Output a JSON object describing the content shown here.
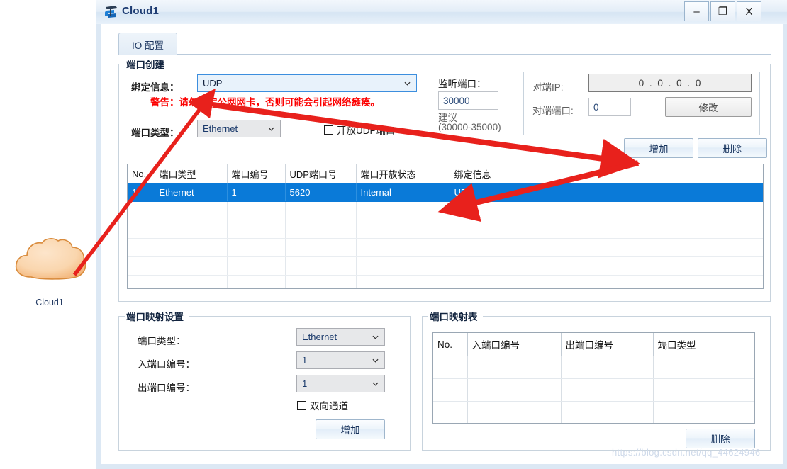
{
  "canvas": {
    "cloud_label": "Cloud1",
    "cloud_color": "#f8cfa4"
  },
  "window": {
    "title": "Cloud1",
    "icon": "cloud-device-icon",
    "controls": {
      "minimize": "–",
      "maximize": "❐",
      "close": "X"
    }
  },
  "tabs": [
    {
      "label": "IO 配置",
      "active": true
    }
  ],
  "port_create": {
    "group_title": "端口创建",
    "bind_info_label": "绑定信息：",
    "bind_info_value": "UDP",
    "warning": "警告：请勿绑定公网网卡，否则可能会引起网络瘫痪。",
    "port_type_label": "端口类型：",
    "port_type_value": "Ethernet",
    "open_udp_label": "开放UDP端口",
    "open_udp_checked": false,
    "listen_port_label": "监听端口：",
    "listen_port_value": "30000",
    "listen_port_hint1": "建议",
    "listen_port_hint2": "(30000-35000)",
    "peer_ip_label": "对端IP:",
    "peer_ip_octets": [
      "0",
      "0",
      "0",
      "0"
    ],
    "peer_port_label": "对端端口:",
    "peer_port_value": "0",
    "modify_button": "修改",
    "add_button": "增加",
    "delete_button": "删除"
  },
  "port_table": {
    "headers": [
      "No.",
      "端口类型",
      "端口编号",
      "UDP端口号",
      "端口开放状态",
      "绑定信息"
    ],
    "rows": [
      {
        "selected": true,
        "cells": [
          "1",
          "Ethernet",
          "1",
          "5620",
          "Internal",
          "UDP"
        ]
      },
      {
        "selected": false,
        "cells": [
          "",
          "",
          "",
          "",
          "",
          ""
        ]
      },
      {
        "selected": false,
        "cells": [
          "",
          "",
          "",
          "",
          "",
          ""
        ]
      },
      {
        "selected": false,
        "cells": [
          "",
          "",
          "",
          "",
          "",
          ""
        ]
      },
      {
        "selected": false,
        "cells": [
          "",
          "",
          "",
          "",
          "",
          ""
        ]
      },
      {
        "selected": false,
        "cells": [
          "",
          "",
          "",
          "",
          "",
          ""
        ]
      },
      {
        "selected": false,
        "cells": [
          "",
          "",
          "",
          "",
          "",
          ""
        ]
      }
    ]
  },
  "port_mapping_settings": {
    "group_title": "端口映射设置",
    "port_type_label": "端口类型：",
    "port_type_value": "Ethernet",
    "in_port_label": "入端口编号：",
    "in_port_value": "1",
    "out_port_label": "出端口编号：",
    "out_port_value": "1",
    "bidirectional_label": "双向通道",
    "bidirectional_checked": false,
    "add_button": "增加"
  },
  "port_mapping_table": {
    "group_title": "端口映射表",
    "headers": [
      "No.",
      "入端口编号",
      "出端口编号",
      "端口类型"
    ],
    "rows": [
      {
        "cells": [
          "",
          "",
          "",
          ""
        ]
      },
      {
        "cells": [
          "",
          "",
          "",
          ""
        ]
      },
      {
        "cells": [
          "",
          "",
          "",
          ""
        ]
      },
      {
        "cells": [
          "",
          "",
          "",
          ""
        ]
      },
      {
        "cells": [
          "",
          "",
          "",
          ""
        ]
      }
    ],
    "delete_button": "删除"
  },
  "watermark": "https://blog.csdn.net/qq_44624946",
  "annotations": {
    "arrow_color": "#e8211c",
    "arrow_cloud_to_bind": "cloud to 绑定信息 combobox",
    "arrow_to_add": "pointer to 增加 button",
    "arrow_to_bind_cell": "pointer to 绑定信息 table cell"
  }
}
